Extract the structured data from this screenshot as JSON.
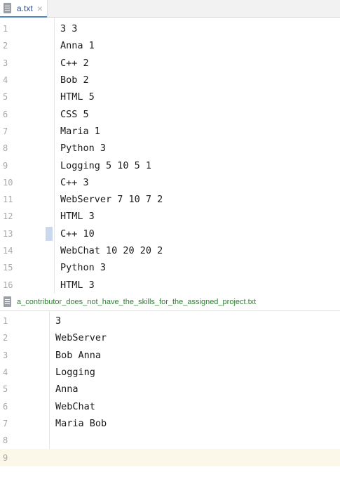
{
  "top_editor": {
    "tab": {
      "label": "a.txt",
      "close": "×",
      "icon": "file-icon"
    },
    "lines": [
      {
        "num": "1",
        "text": "3 3"
      },
      {
        "num": "2",
        "text": "Anna 1"
      },
      {
        "num": "3",
        "text": "C++ 2"
      },
      {
        "num": "4",
        "text": "Bob 2"
      },
      {
        "num": "5",
        "text": "HTML 5"
      },
      {
        "num": "6",
        "text": "CSS 5"
      },
      {
        "num": "7",
        "text": "Maria 1"
      },
      {
        "num": "8",
        "text": "Python 3"
      },
      {
        "num": "9",
        "text": "Logging 5 10 5 1"
      },
      {
        "num": "10",
        "text": "C++ 3"
      },
      {
        "num": "11",
        "text": "WebServer 7 10 7 2"
      },
      {
        "num": "12",
        "text": "HTML 3"
      },
      {
        "num": "13",
        "text": "C++ 10"
      },
      {
        "num": "14",
        "text": "WebChat 10 20 20 2"
      },
      {
        "num": "15",
        "text": "Python 3"
      },
      {
        "num": "16",
        "text": "HTML 3"
      }
    ],
    "marked_line": "13"
  },
  "bottom_editor": {
    "tab": {
      "label": "a_contributor_does_not_have_the_skills_for_the_assigned_project.txt",
      "icon": "file-icon"
    },
    "lines": [
      {
        "num": "1",
        "text": "3"
      },
      {
        "num": "2",
        "text": "WebServer"
      },
      {
        "num": "3",
        "text": "Bob Anna"
      },
      {
        "num": "4",
        "text": "Logging"
      },
      {
        "num": "5",
        "text": "Anna"
      },
      {
        "num": "6",
        "text": "WebChat"
      },
      {
        "num": "7",
        "text": "Maria Bob"
      },
      {
        "num": "8",
        "text": ""
      },
      {
        "num": "9",
        "text": ""
      }
    ],
    "current_line": "9"
  },
  "colors": {
    "tab_label_top": "#2b4e9a",
    "tab_label_bottom": "#2e7d32",
    "line_number": "#a8a8a8",
    "marker": "#c9d8ec",
    "current_line_bg": "#fbf8e9"
  }
}
